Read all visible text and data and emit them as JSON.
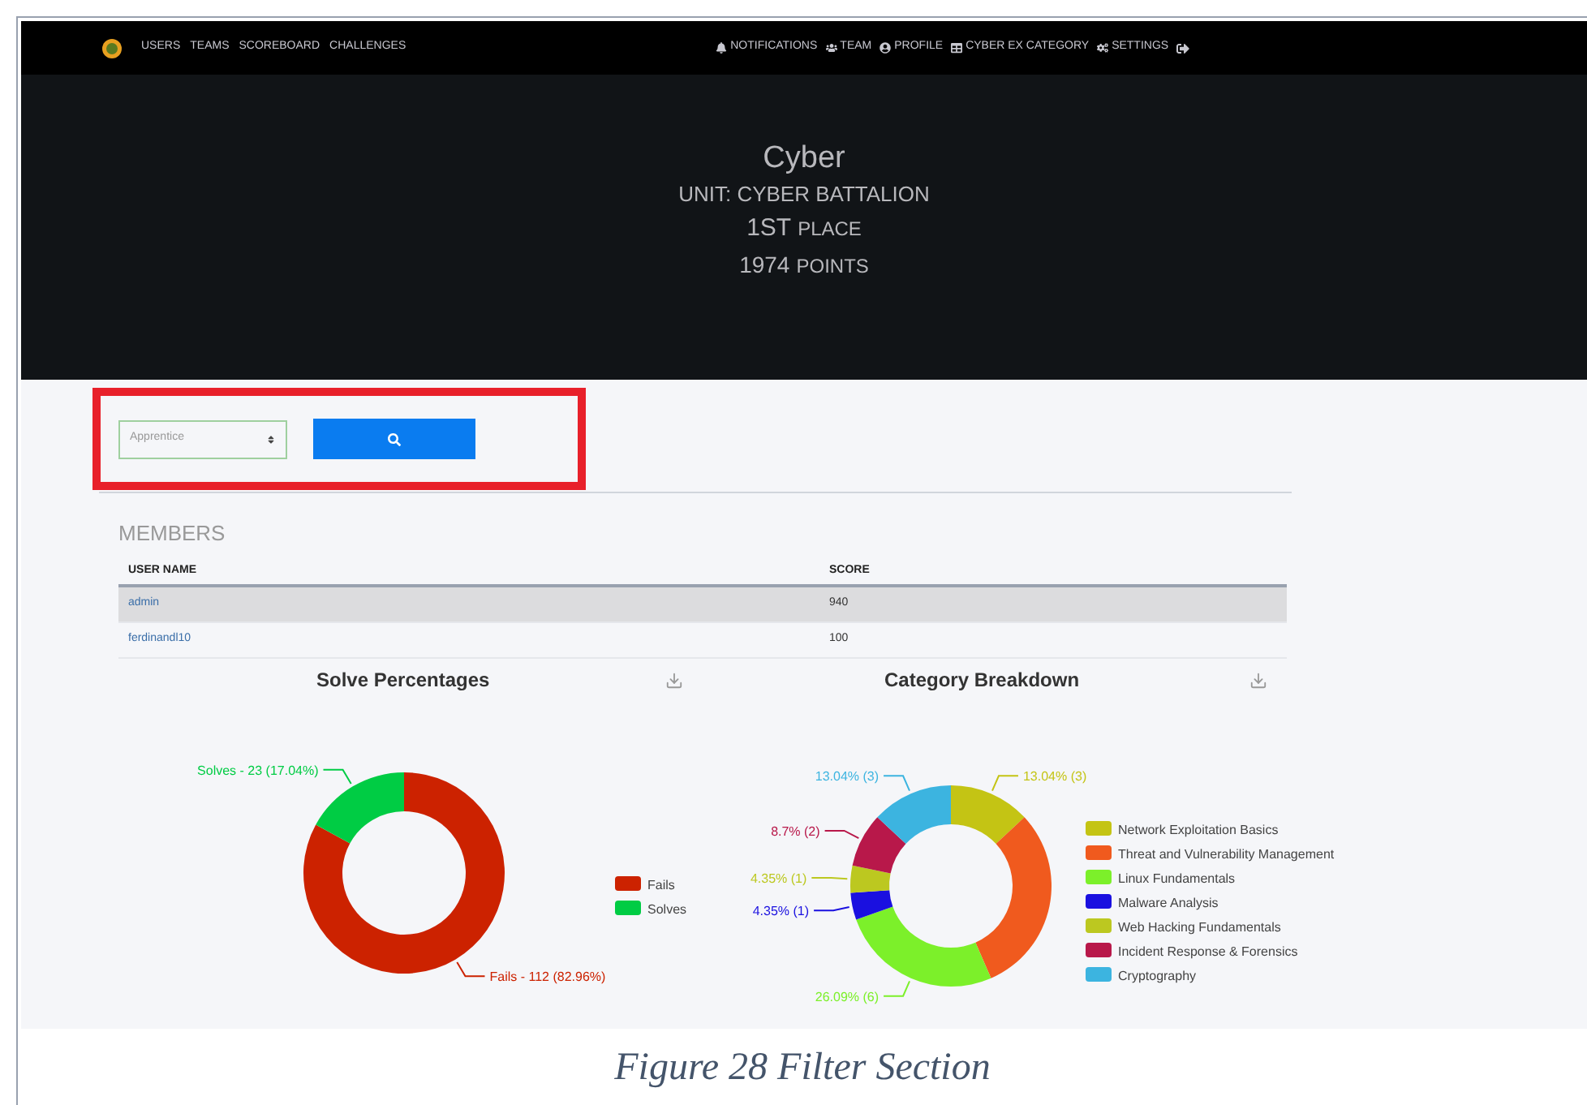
{
  "navbar": {
    "links": [
      "USERS",
      "TEAMS",
      "SCOREBOARD",
      "CHALLENGES"
    ],
    "right_links": [
      "NOTIFICATIONS",
      "TEAM",
      "PROFILE",
      "CYBER EX CATEGORY",
      "SETTINGS"
    ]
  },
  "hero": {
    "team_name": "Cyber",
    "unit": "UNIT: CYBER BATTALION",
    "place_rank": "1ST",
    "place_label": "PLACE",
    "points": "1974",
    "points_label": "POINTS"
  },
  "filter": {
    "select": {
      "value": "Apprentice"
    },
    "highlighted": true
  },
  "members": {
    "title": "MEMBERS",
    "columns": [
      "USER NAME",
      "SCORE"
    ],
    "rows": [
      {
        "cells": [
          "admin",
          "940"
        ],
        "selected": true
      },
      {
        "cells": [
          "ferdinandl10",
          "100"
        ],
        "selected": false
      }
    ]
  },
  "charts": [
    {
      "title": "Solve Percentages",
      "chart_data": {
        "type": "donut",
        "legend": "right",
        "categories": [
          "Fails",
          "Solves"
        ],
        "colors": [
          "#cc2200",
          "#00cc44"
        ],
        "series": [
          {
            "values": [
              82.96,
              17.04
            ]
          }
        ],
        "value_labels": [
          "Fails - 112 (82.96%)",
          "Solves - 23 (17.04%)"
        ]
      }
    },
    {
      "title": "Category Breakdown",
      "chart_data": {
        "type": "donut",
        "legend": "right",
        "categories": [
          "Network Exploitation Basics",
          "Threat and Vulnerability Management",
          "Linux Fundamentals",
          "Malware Analysis",
          "Web Hacking Fundamentals",
          "Incident Response & Forensics",
          "Cryptography"
        ],
        "colors": [
          "#c4c414",
          "#f05a1e",
          "#7cf02a",
          "#1a10e0",
          "#bcc820",
          "#b8184a",
          "#3cb4e0"
        ],
        "series": [
          {
            "values": [
              13.04,
              30.43,
              26.09,
              4.35,
              4.35,
              8.7,
              13.04
            ]
          }
        ],
        "value_labels": [
          "13.04% (3)",
          null,
          "26.09% (6)",
          "4.35% (1)",
          "4.35% (1)",
          "8.7% (2)",
          "13.04% (3)"
        ]
      }
    }
  ],
  "caption": "Figure 28 Filter Section"
}
